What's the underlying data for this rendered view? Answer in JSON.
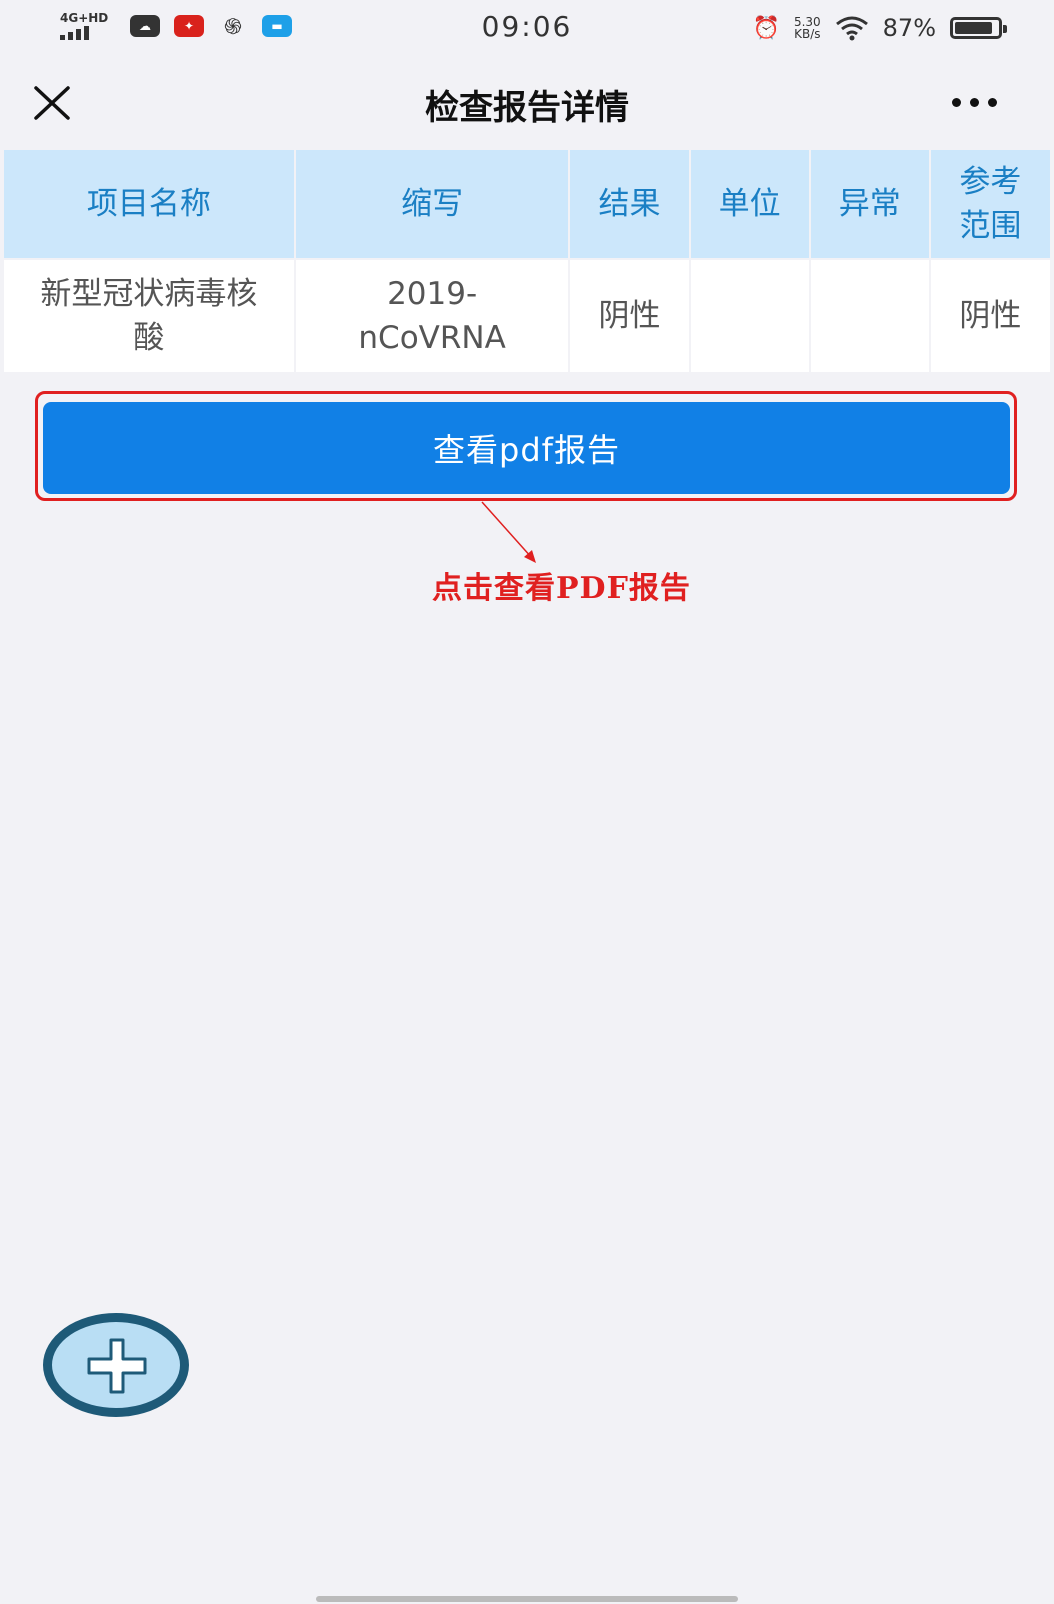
{
  "status_bar": {
    "network": "4G+HD",
    "time": "09:06",
    "speed_value": "5.30",
    "speed_unit": "KB/s",
    "battery_percent": "87%",
    "battery_level": 0.87
  },
  "nav": {
    "title": "检查报告详情",
    "close_icon": "close-icon",
    "more_icon": "more-icon"
  },
  "table": {
    "headers": {
      "name": "项目名称",
      "abbr": "缩写",
      "result": "结果",
      "unit": "单位",
      "abnormal": "异常",
      "range_line1": "参考",
      "range_line2": "范围"
    },
    "rows": [
      {
        "name_line1": "新型冠状病毒核",
        "name_line2": "酸",
        "abbr_line1": "2019-",
        "abbr_line2": "nCoVRNA",
        "result": "阴性",
        "unit": "",
        "abnormal": "",
        "range": "阴性"
      }
    ]
  },
  "pdf_button_label": "查看pdf报告",
  "annotation": "点击查看PDF报告",
  "colors": {
    "primary_button": "#1180e6",
    "header_bg": "#cce7fb",
    "header_text": "#1a7fc4",
    "annotation_red": "#e02020"
  },
  "fab_icon": "plus-icon"
}
